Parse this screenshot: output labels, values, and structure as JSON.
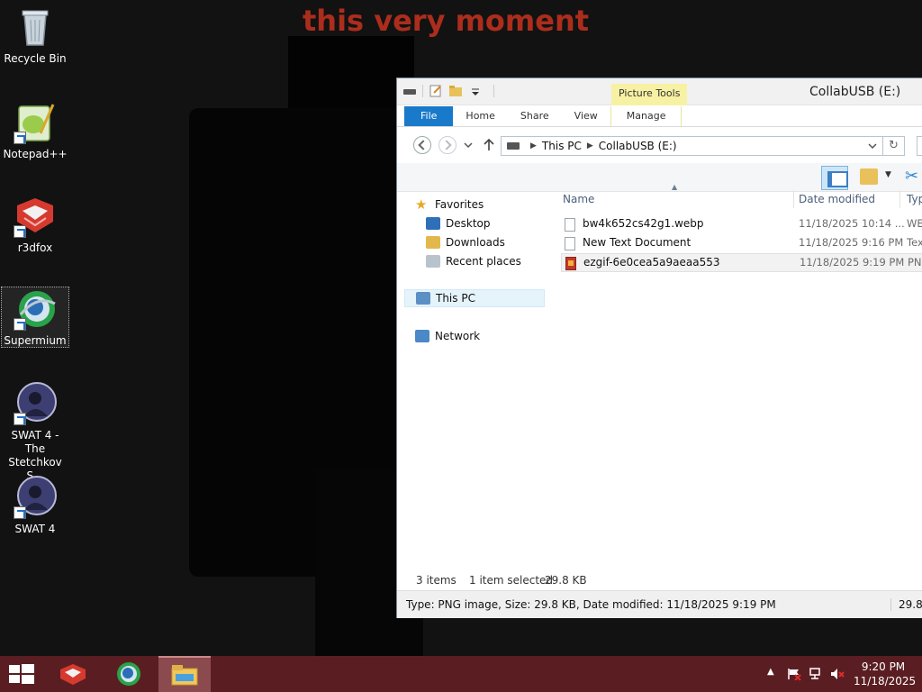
{
  "wallpaper": {
    "text": "this very moment"
  },
  "desktop": {
    "icons": [
      {
        "label": "Recycle Bin"
      },
      {
        "label": "Notepad++"
      },
      {
        "label": "r3dfox"
      },
      {
        "label": "Supermium"
      },
      {
        "label": "SWAT 4 - The Stetchkov S..."
      },
      {
        "label": "SWAT 4"
      }
    ]
  },
  "explorer": {
    "title": "CollabUSB (E:)",
    "context_tab": "Picture Tools",
    "tabs": [
      "File",
      "Home",
      "Share",
      "View",
      "Manage"
    ],
    "address": {
      "segments": [
        "This PC",
        "CollabUSB (E:)"
      ]
    },
    "nav": {
      "favorites": "Favorites",
      "desktop": "Desktop",
      "downloads": "Downloads",
      "recent": "Recent places",
      "this_pc": "This PC",
      "network": "Network"
    },
    "columns": {
      "name": "Name",
      "date": "Date modified",
      "type": "Typ"
    },
    "files": [
      {
        "name": "bw4k652cs42g1.webp",
        "date": "11/18/2025 10:14 ...",
        "type": "WE"
      },
      {
        "name": "New Text Document",
        "date": "11/18/2025 9:16 PM",
        "type": "Tex"
      },
      {
        "name": "ezgif-6e0cea5a9aeaa553",
        "date": "11/18/2025 9:19 PM",
        "type": "PN"
      }
    ],
    "status": {
      "items": "3 items",
      "selected": "1 item selected",
      "size": "29.8 KB"
    },
    "details": {
      "text": "Type: PNG image, Size: 29.8 KB, Date modified: 11/18/2025 9:19 PM",
      "size": "29.8"
    }
  },
  "taskbar": {
    "clock_time": "9:20 PM",
    "clock_date": "11/18/2025"
  },
  "colors": {
    "taskbar": "#5a1e22",
    "file_tab": "#1979ca",
    "picture_tools": "#f7f1a3"
  }
}
